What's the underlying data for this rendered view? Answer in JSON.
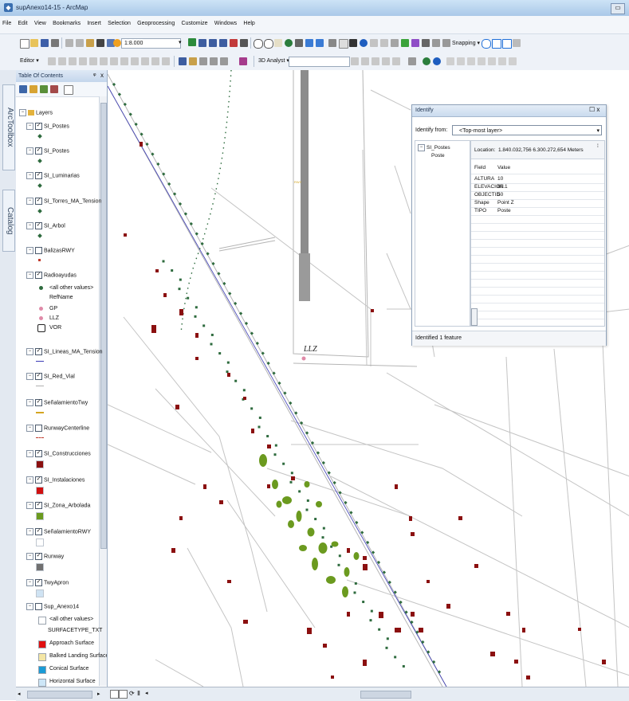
{
  "window": {
    "title": "supAnexo14-15 - ArcMap",
    "minimize": "▭"
  },
  "menu": [
    "File",
    "Edit",
    "View",
    "Bookmarks",
    "Insert",
    "Selection",
    "Geoprocessing",
    "Customize",
    "Windows",
    "Help"
  ],
  "toolbar": {
    "scale": "1:8.000",
    "snapping_label": "Snapping ▾",
    "editor_label": "Editor ▾",
    "analyst_label": "3D Analyst ▾"
  },
  "side_tabs": [
    "ArcToolbox",
    "Catalog"
  ],
  "toc": {
    "title": "Table Of Contents",
    "pin": "ᵠ",
    "close": "x",
    "root": "Layers",
    "layers": [
      {
        "name": "SI_Postes",
        "checked": true,
        "sym": "dot",
        "color": "#2e6b3e"
      },
      {
        "name": "SI_Postes",
        "checked": true,
        "sym": "dot",
        "color": "#2e6b3e"
      },
      {
        "name": "SI_Luminarias",
        "checked": true,
        "sym": "dot",
        "color": "#2e6b3e"
      },
      {
        "name": "SI_Torres_MA_Tension",
        "checked": true,
        "sym": "dot",
        "color": "#2e6b3e"
      },
      {
        "name": "SI_Arbol",
        "checked": true,
        "sym": "dot",
        "color": "#2e6b3e"
      },
      {
        "name": "BalizasRWY",
        "checked": false,
        "sym": "dot-small",
        "color": "#c0392b"
      },
      {
        "name": "Radioayudas",
        "checked": true,
        "sym": "none",
        "color": ""
      },
      {
        "name": "SI_Lineas_MA_Tension",
        "checked": true,
        "sym": "line",
        "color": "#3b3bb5"
      },
      {
        "name": "SI_Red_Vial",
        "checked": true,
        "sym": "line",
        "color": "#b0b0b0"
      },
      {
        "name": "SeñalamientoTwy",
        "checked": true,
        "sym": "line",
        "color": "#d4a520"
      },
      {
        "name": "RunwayCenterline",
        "checked": false,
        "sym": "dash",
        "color": "#c0392b"
      },
      {
        "name": "SI_Construcciones",
        "checked": true,
        "sym": "square",
        "color": "#8b1010"
      },
      {
        "name": "SI_Instalaciones",
        "checked": true,
        "sym": "square",
        "color": "#d01010"
      },
      {
        "name": "SI_Zona_Arbolada",
        "checked": true,
        "sym": "square",
        "color": "#6b9a1f"
      },
      {
        "name": "SeñalamientoRWY",
        "checked": true,
        "sym": "square",
        "color": "#ffffff"
      },
      {
        "name": "Runway",
        "checked": true,
        "sym": "square",
        "color": "#707070"
      },
      {
        "name": "TwyApron",
        "checked": true,
        "sym": "square",
        "color": "#cfe3f3"
      },
      {
        "name": "Sup_Anexo14",
        "checked": false,
        "sym": "none",
        "color": ""
      }
    ],
    "radio_legend": [
      "<all other values>",
      "RefName",
      "GP",
      "LLZ",
      "VOR"
    ],
    "sup_legend": [
      {
        "label": "<all other values>",
        "color": "#ffffff"
      },
      {
        "label": "SURFACETYPE_TXT",
        "color": ""
      },
      {
        "label": "Approach Surface",
        "color": "#e01010"
      },
      {
        "label": "Balked Landing Surface",
        "color": "#f4e6a5"
      },
      {
        "label": "Conical Surface",
        "color": "#1a9bd6"
      },
      {
        "label": "Horizontal Surface",
        "color": "#cde6f7"
      }
    ]
  },
  "map": {
    "llz_label": "LLZ",
    "tiny_label": "RWY"
  },
  "identify": {
    "title": "Identify",
    "close": "☐ x",
    "from_label": "Identify from:",
    "from_value": "<Top-most layer>",
    "tree_layer": "SI_Postes",
    "tree_item": "Poste",
    "location_label": "Location:",
    "location_value": "1.840.032,756  6.300.272,654 Meters",
    "col_field": "Field",
    "col_value": "Value",
    "rows": [
      {
        "field": "ALTURA",
        "value": "10"
      },
      {
        "field": "ELEVACION",
        "value": "60.1"
      },
      {
        "field": "OBJECTID",
        "value": "50"
      },
      {
        "field": "Shape",
        "value": "Point Z"
      },
      {
        "field": "TIPO",
        "value": "Poste"
      }
    ],
    "status": "Identified 1 feature"
  },
  "colors": {
    "pole": "#2e6b3e",
    "building": "#8b1010",
    "tree_zone": "#6b9a1f",
    "power_line": "#3b3bb5",
    "road": "#b5b5b5",
    "llz": "#e08aa8"
  }
}
